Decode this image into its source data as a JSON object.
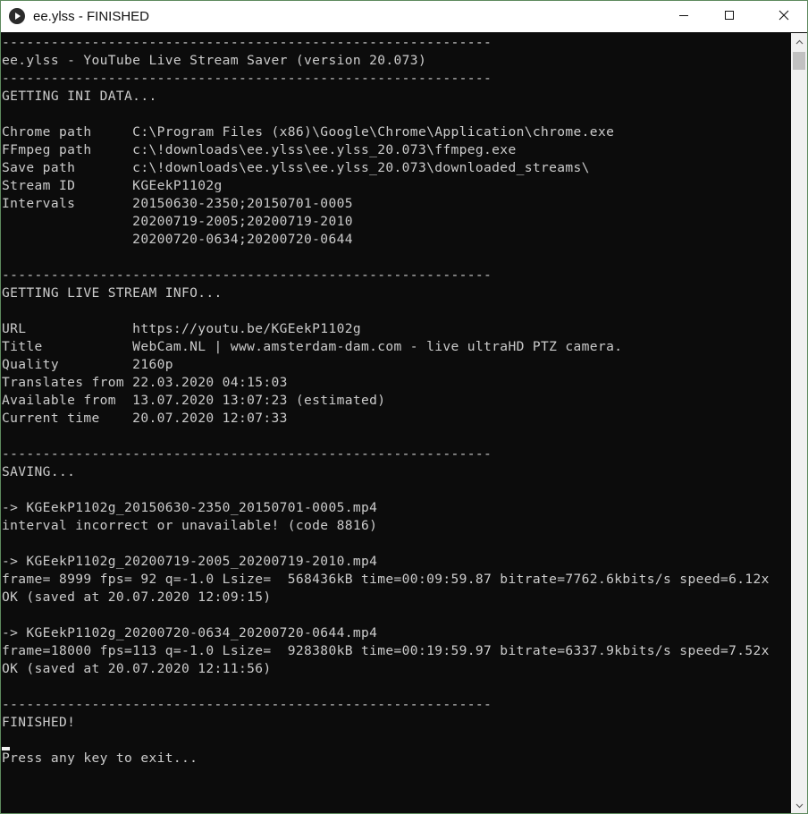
{
  "window": {
    "title": "ee.ylss - FINISHED"
  },
  "console": {
    "lines": [
      "------------------------------------------------------------",
      "ee.ylss - YouTube Live Stream Saver (version 20.073)",
      "------------------------------------------------------------",
      "GETTING INI DATA...",
      "",
      "Chrome path     C:\\Program Files (x86)\\Google\\Chrome\\Application\\chrome.exe",
      "FFmpeg path     c:\\!downloads\\ee.ylss\\ee.ylss_20.073\\ffmpeg.exe",
      "Save path       c:\\!downloads\\ee.ylss\\ee.ylss_20.073\\downloaded_streams\\",
      "Stream ID       KGEekP1102g",
      "Intervals       20150630-2350;20150701-0005",
      "                20200719-2005;20200719-2010",
      "                20200720-0634;20200720-0644",
      "",
      "------------------------------------------------------------",
      "GETTING LIVE STREAM INFO...",
      "",
      "URL             https://youtu.be/KGEekP1102g",
      "Title           WebCam.NL | www.amsterdam-dam.com - live ultraHD PTZ camera.",
      "Quality         2160p",
      "Translates from 22.03.2020 04:15:03",
      "Available from  13.07.2020 13:07:23 (estimated)",
      "Current time    20.07.2020 12:07:33",
      "",
      "------------------------------------------------------------",
      "SAVING...",
      "",
      "-> KGEekP1102g_20150630-2350_20150701-0005.mp4",
      "interval incorrect or unavailable! (code 8816)",
      "",
      "-> KGEekP1102g_20200719-2005_20200719-2010.mp4",
      "frame= 8999 fps= 92 q=-1.0 Lsize=  568436kB time=00:09:59.87 bitrate=7762.6kbits/s speed=6.12x",
      "OK (saved at 20.07.2020 12:09:15)",
      "",
      "-> KGEekP1102g_20200720-0634_20200720-0644.mp4",
      "frame=18000 fps=113 q=-1.0 Lsize=  928380kB time=00:19:59.97 bitrate=6337.9kbits/s speed=7.52x",
      "OK (saved at 20.07.2020 12:11:56)",
      "",
      "------------------------------------------------------------",
      "FINISHED!",
      "",
      "Press any key to exit..."
    ]
  },
  "icons": {
    "app": "play-icon",
    "minimize": "minimize-icon",
    "maximize": "maximize-icon",
    "close": "close-icon",
    "scroll_up": "chevron-up-icon",
    "scroll_down": "chevron-down-icon"
  },
  "colors": {
    "console_bg": "#0c0c0c",
    "console_text": "#cccccc",
    "window_border": "#5e8a5e"
  }
}
